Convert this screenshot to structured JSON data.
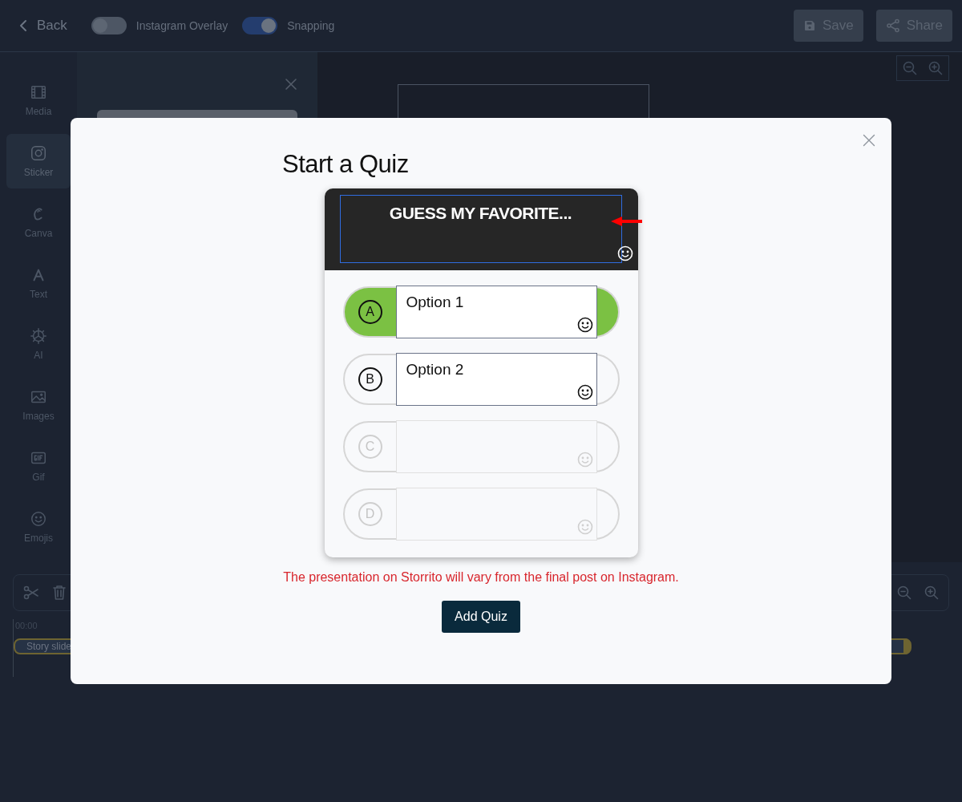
{
  "topbar": {
    "back": "Back",
    "toggles": [
      {
        "label": "Instagram Overlay",
        "on": false
      },
      {
        "label": "Snapping",
        "on": true
      }
    ],
    "buttons": [
      {
        "kind": "save",
        "label": "Save"
      },
      {
        "kind": "share",
        "label": "Share"
      }
    ]
  },
  "sidebar": {
    "items": [
      {
        "kind": "media",
        "label": "Media",
        "selected": false
      },
      {
        "kind": "sticker",
        "label": "Sticker",
        "selected": true
      },
      {
        "kind": "canva",
        "label": "Canva",
        "selected": false
      },
      {
        "kind": "text",
        "label": "Text",
        "selected": false
      },
      {
        "kind": "ai",
        "label": "AI",
        "selected": false
      },
      {
        "kind": "images",
        "label": "Images",
        "selected": false
      },
      {
        "kind": "gif",
        "label": "Gif",
        "selected": false
      },
      {
        "kind": "emojis",
        "label": "Emojis",
        "selected": false
      }
    ]
  },
  "timeline": {
    "time": "00:00",
    "clip": "Story slide"
  },
  "modal": {
    "title": "Start a Quiz",
    "question": "GUESS MY FAVORITE...",
    "options": [
      {
        "letter": "A",
        "value": "Option 1",
        "correct": true,
        "active": true
      },
      {
        "letter": "B",
        "value": "Option 2",
        "correct": false,
        "active": true
      },
      {
        "letter": "C",
        "correct": false,
        "active": false
      },
      {
        "letter": "D",
        "correct": false,
        "active": false
      }
    ],
    "warning": "The presentation on Storrito will vary from the final post on Instagram.",
    "submit": "Add Quiz"
  }
}
